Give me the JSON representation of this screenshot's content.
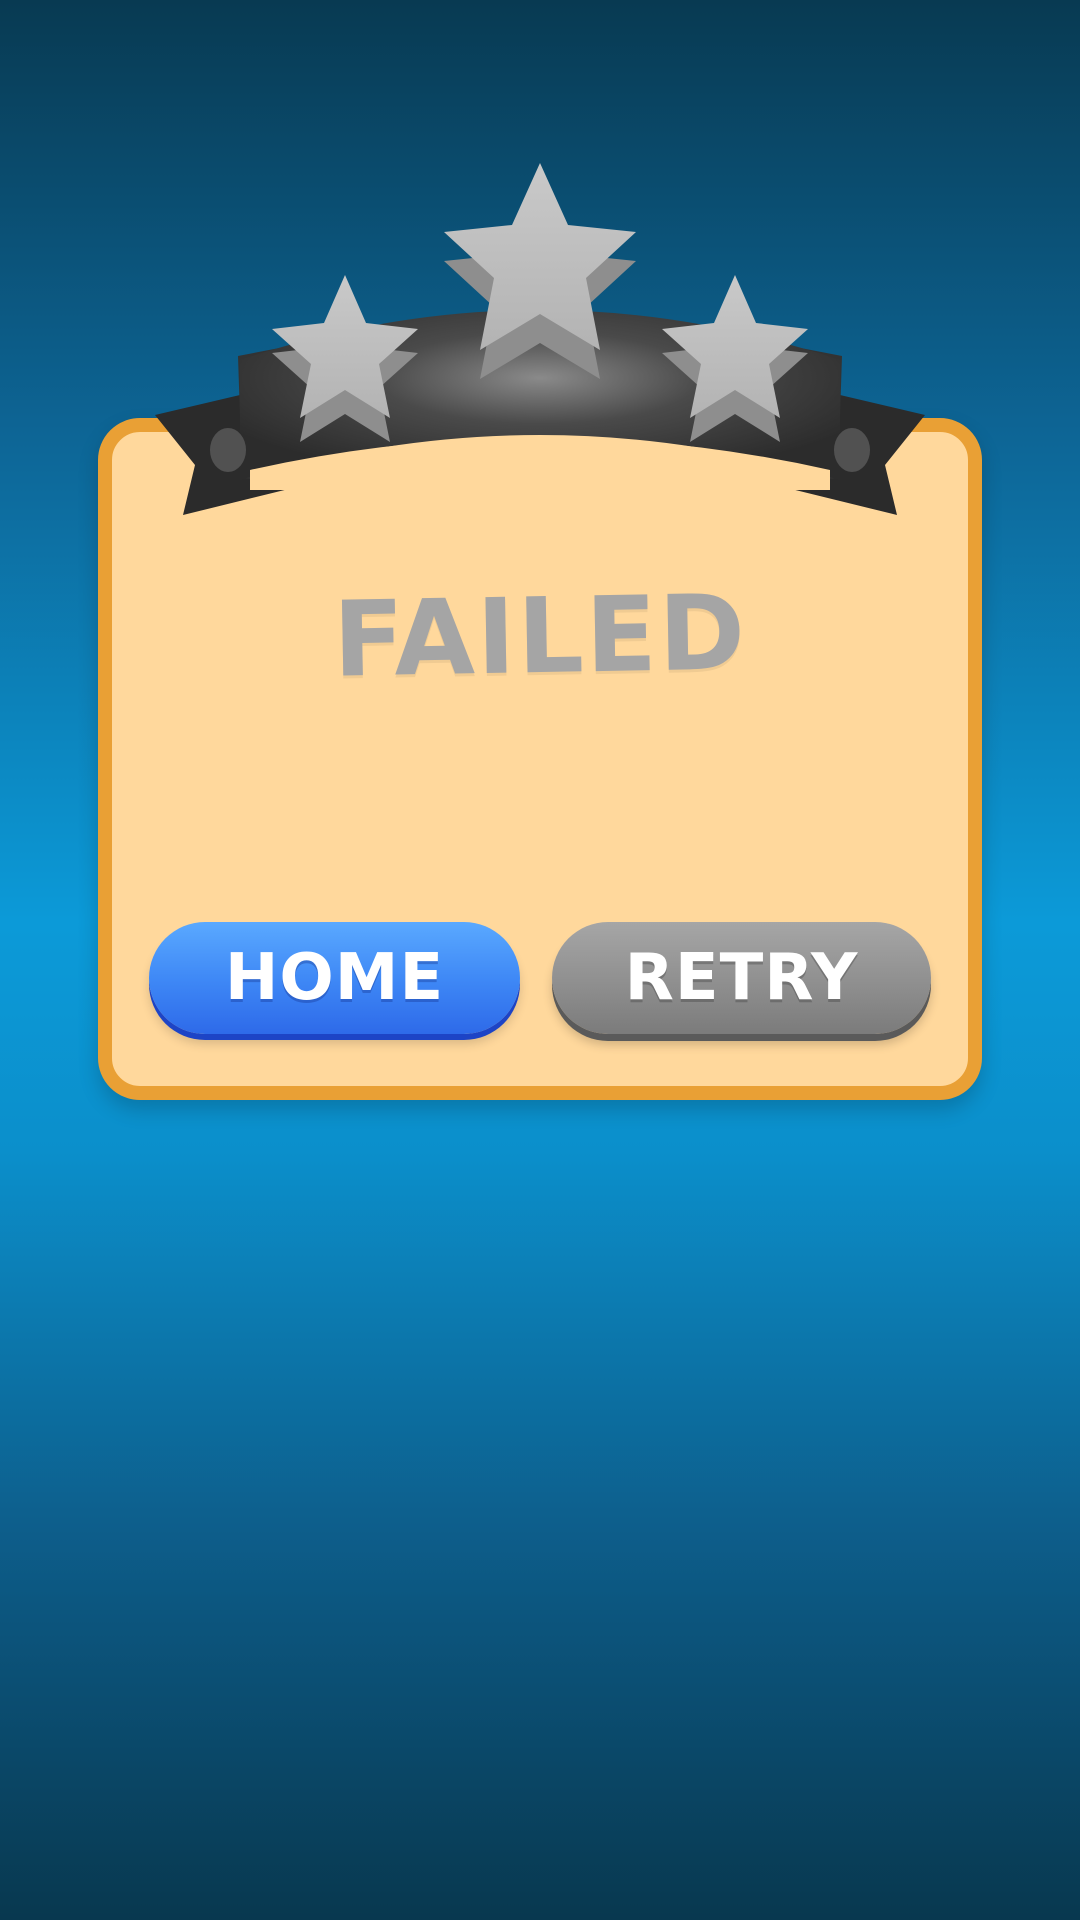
{
  "screen": {
    "title": "FAILED",
    "stars": {
      "earned": 0,
      "total": 3
    }
  },
  "buttons": {
    "home_label": "HOME",
    "retry_label": "RETRY"
  },
  "colors": {
    "background_top": "#083a52",
    "background_mid": "#0c9ad8",
    "panel_fill": "#ffd89c",
    "panel_border": "#e9a035",
    "ribbon": "#3a3a3a",
    "star_inactive": "#b9b9b9",
    "title_text": "#a5a5a5",
    "home_button": "#3d86f5",
    "retry_button": "#8f8f8f"
  },
  "icons": [
    "star-icon-left",
    "star-icon-center",
    "star-icon-right"
  ]
}
